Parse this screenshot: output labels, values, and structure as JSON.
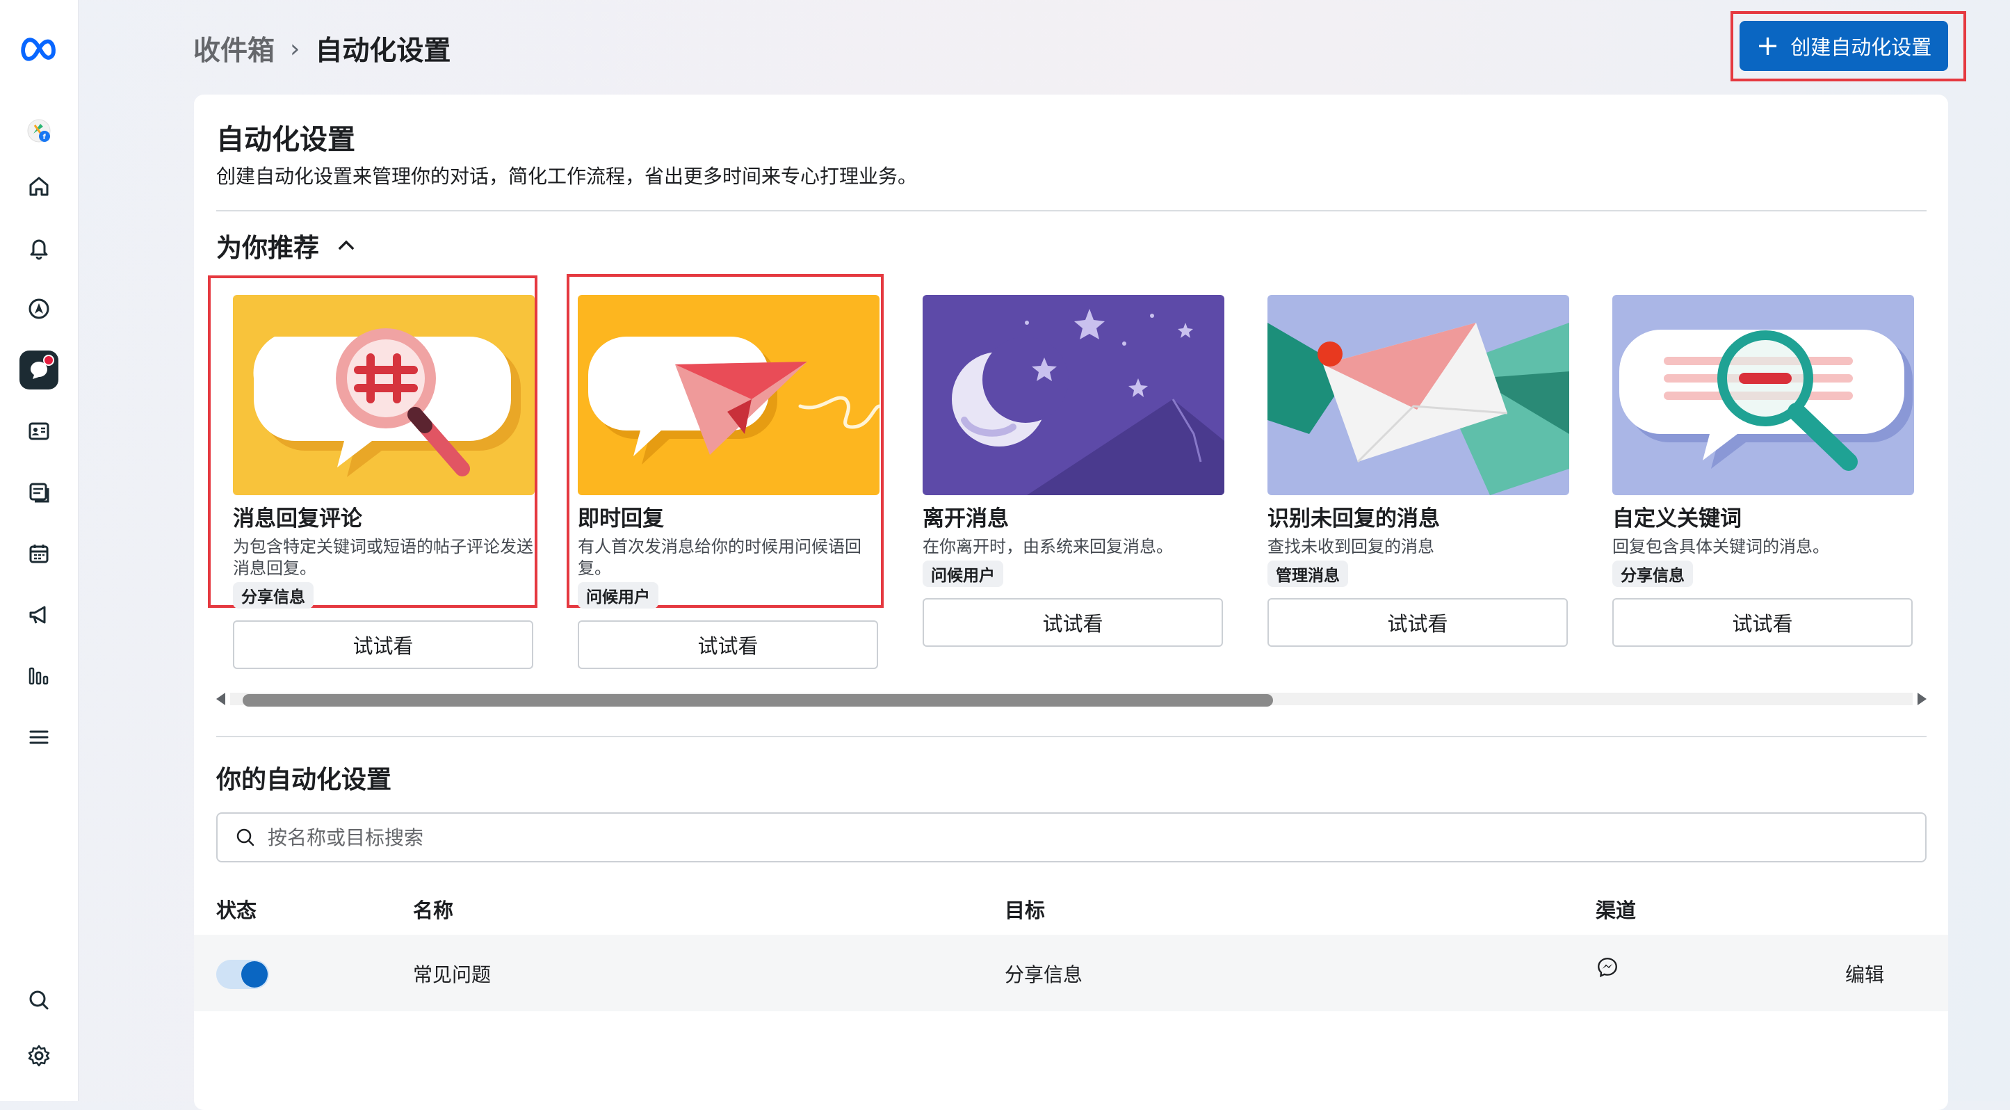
{
  "breadcrumb": {
    "parent": "收件箱",
    "current": "自动化设置"
  },
  "create_button": {
    "label": "创建自动化设置"
  },
  "panel": {
    "title": "自动化设置",
    "description": "创建自动化设置来管理你的对话，简化工作流程，省出更多时间来专心打理业务。"
  },
  "recommended": {
    "heading": "为你推荐",
    "cards": [
      {
        "title": "消息回复评论",
        "desc": "为包含特定关键词或短语的帖子评论发送消息回复。",
        "tag": "分享信息",
        "button": "试试看"
      },
      {
        "title": "即时回复",
        "desc": "有人首次发消息给你的时候用问候语回复。",
        "tag": "问候用户",
        "button": "试试看"
      },
      {
        "title": "离开消息",
        "desc": "在你离开时，由系统来回复消息。",
        "tag": "问候用户",
        "button": "试试看"
      },
      {
        "title": "识别未回复的消息",
        "desc": "查找未收到回复的消息",
        "tag": "管理消息",
        "button": "试试看"
      },
      {
        "title": "自定义关键词",
        "desc": "回复包含具体关键词的消息。",
        "tag": "分享信息",
        "button": "试试看"
      }
    ],
    "scroll_position": 0.6
  },
  "my_automations": {
    "heading": "你的自动化设置",
    "search_placeholder": "按名称或目标搜索",
    "columns": {
      "status": "状态",
      "name": "名称",
      "goal": "目标",
      "channel": "渠道"
    },
    "rows": [
      {
        "enabled": true,
        "name": "常见问题",
        "goal": "分享信息",
        "channel_icon": "messenger-icon",
        "action": "编辑"
      }
    ]
  },
  "colors": {
    "accent": "#0a66c2",
    "highlight": "#e53940"
  }
}
